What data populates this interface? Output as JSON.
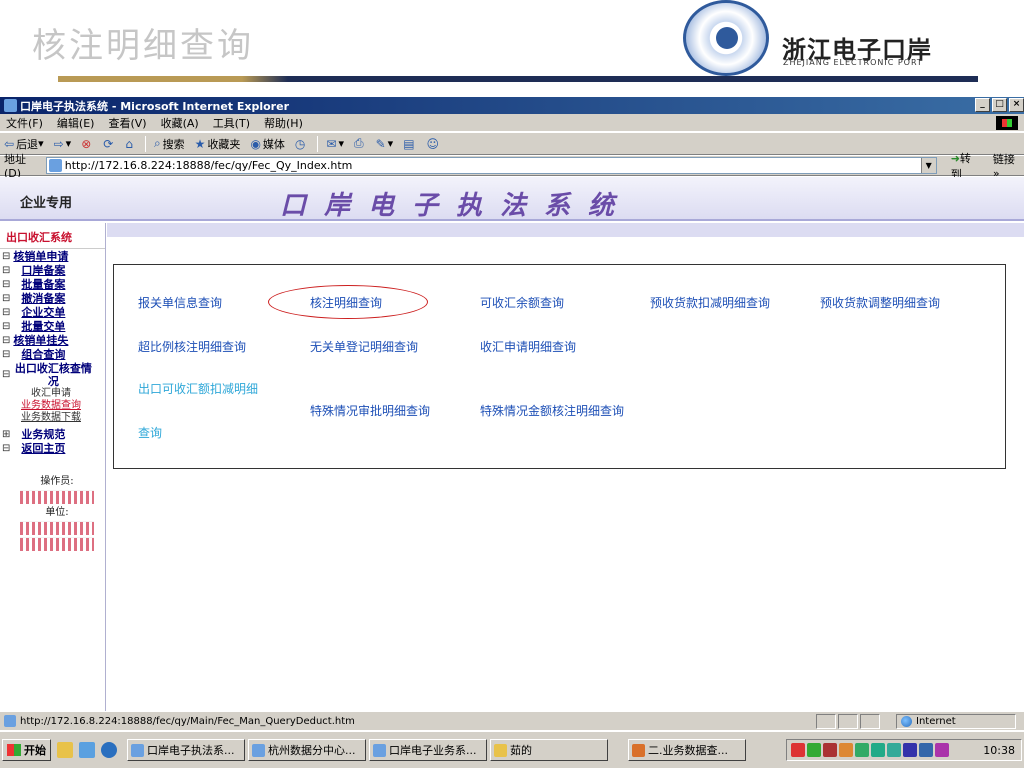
{
  "slide": {
    "title": "核注明细查询",
    "brand_cn": "浙江电子口岸",
    "brand_en": "ZHEJIANG ELECTRONIC PORT"
  },
  "window": {
    "title": "口岸电子执法系统 - Microsoft Internet Explorer",
    "controls": [
      "_",
      "□",
      "×"
    ]
  },
  "menu": [
    "文件(F)",
    "编辑(E)",
    "查看(V)",
    "收藏(A)",
    "工具(T)",
    "帮助(H)"
  ],
  "toolbar": {
    "back": "后退",
    "search": "搜索",
    "favorites": "收藏夹",
    "media": "媒体"
  },
  "address": {
    "label": "地址(D)",
    "url": "http://172.16.8.224:18888/fec/qy/Fec_Qy_Index.htm",
    "go": "转到",
    "links": "链接 »"
  },
  "banner": {
    "left": "企业专用",
    "title": "口岸电子执法系统"
  },
  "sidebar": {
    "heading": "出口收汇系统",
    "items": [
      {
        "box": "⊟",
        "label": "核销单申请"
      },
      {
        "box": "⊟",
        "label": "口岸备案"
      },
      {
        "box": "⊟",
        "label": "批量备案"
      },
      {
        "box": "⊟",
        "label": "撤消备案"
      },
      {
        "box": "⊟",
        "label": "企业交单"
      },
      {
        "box": "⊟",
        "label": "批量交单"
      },
      {
        "box": "⊟",
        "label": "核销单挂失"
      },
      {
        "box": "⊟",
        "label": "组合查询"
      },
      {
        "box": "⊟",
        "label": "出口收汇核查情况"
      }
    ],
    "subitems": [
      "收汇申请",
      "业务数据查询",
      "业务数据下载"
    ],
    "items_after": [
      {
        "box": "⊞",
        "label": "业务规范"
      },
      {
        "box": "⊟",
        "label": "返回主页"
      }
    ],
    "operator_label": "操作员:",
    "unit_label": "单位:"
  },
  "links": {
    "r1c1": "报关单信息查询",
    "r1c2": "核注明细查询",
    "r1c3": "可收汇余额查询",
    "r1c4": "预收货款扣减明细查询",
    "r1c5": "预收货款调整明细查询",
    "r2c1": "超比例核注明细查询",
    "r2c2": "无关单登记明细查询",
    "r2c3": "收汇申请明细查询",
    "r3c1a": "出口可收汇额扣减明细",
    "r3c1b": "查询",
    "r3c2": "特殊情况审批明细查询",
    "r3c3": "特殊情况金额核注明细查询"
  },
  "status": {
    "url": "http://172.16.8.224:18888/fec/qy/Main/Fec_Man_QueryDeduct.htm",
    "zone": "Internet"
  },
  "taskbar": {
    "start": "开始",
    "tasks": [
      "口岸电子执法系...",
      "杭州数据分中心...",
      "口岸电子业务系...",
      "茹的",
      "二.业务数据查..."
    ],
    "clock": "10:38"
  }
}
